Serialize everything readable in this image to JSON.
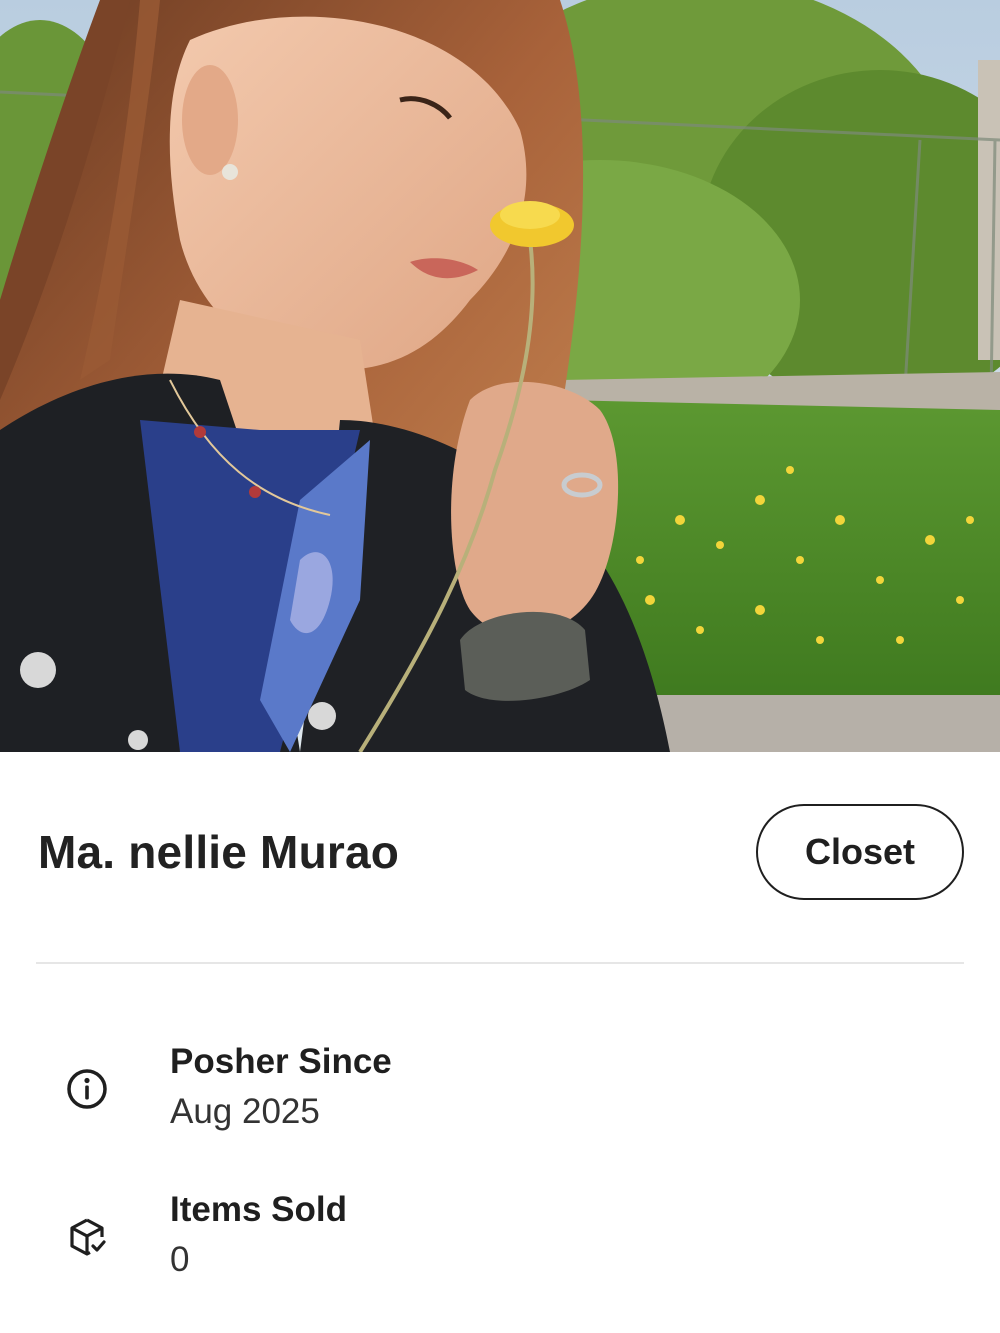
{
  "profile": {
    "name": "Ma. nellie Murao",
    "closet_label": "Closet",
    "photo_icon": "profile-photo"
  },
  "info": {
    "posher_since": {
      "label": "Posher Since",
      "value": "Aug 2025",
      "icon": "info-icon"
    },
    "items_sold": {
      "label": "Items Sold",
      "value": "0",
      "icon": "package-check-icon"
    }
  },
  "colors": {
    "text_primary": "#222222",
    "divider": "#e6e6e6",
    "button_border": "#1f1f1f"
  }
}
